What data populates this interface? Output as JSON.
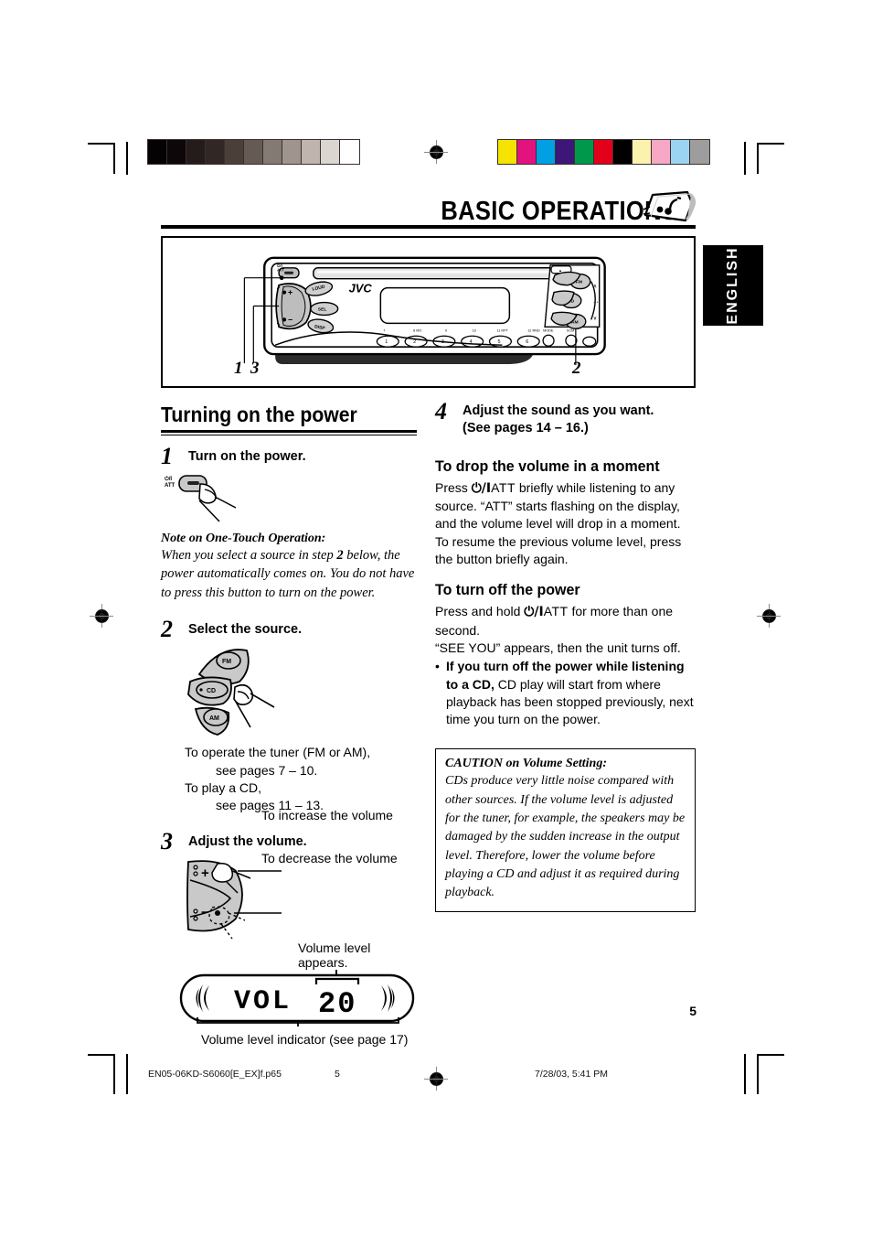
{
  "document": {
    "chapter_title": "BASIC OPERATIONS",
    "language_tab": "ENGLISH",
    "page_number": "5"
  },
  "unit_diagram": {
    "brand": "JVC",
    "callouts": [
      "1",
      "3",
      "2"
    ],
    "preset_numbers": [
      "1",
      "2",
      "3",
      "4",
      "5",
      "6"
    ],
    "band_labels": [
      "7",
      "8  MO",
      "9",
      "10",
      "11  RPT",
      "12  RND"
    ],
    "left_buttons": [
      "LOUD",
      "SEL",
      "DISP"
    ],
    "source_buttons": [
      "FM",
      "CD",
      "AM"
    ],
    "small_buttons": [
      "MODE",
      "SCM"
    ],
    "power_label_top": "ATT"
  },
  "left_column": {
    "section_heading": "Turning on the power",
    "steps": [
      {
        "number": "1",
        "title": "Turn on the power.",
        "icon_labels": [
          "ATT"
        ],
        "note_heading": "Note on One-Touch Operation:",
        "note_body_part1": "When you select a source in step ",
        "note_body_bold": "2",
        "note_body_part2": " below, the power automatically comes on. You do not have to press this button to turn on the power."
      },
      {
        "number": "2",
        "title": "Select the source.",
        "source_buttons": [
          "FM",
          "CD",
          "AM"
        ],
        "lines": [
          "To operate the tuner (FM or AM),",
          "see pages 7 – 10.",
          "To play a CD,",
          "see pages 11 – 13."
        ]
      },
      {
        "number": "3",
        "title": "Adjust the volume.",
        "increase_label": "To increase the volume",
        "decrease_label": "To decrease the volume",
        "plus_sign": "+",
        "minus_sign": "–",
        "display_caption_top": "Volume level appears.",
        "display_caption_bottom": "Volume level indicator (see page 17)",
        "display_text": "VOL",
        "display_value": "20"
      }
    ]
  },
  "right_column": {
    "step4": {
      "number": "4",
      "title_line1": "Adjust the sound as you want.",
      "title_line2": "(See pages 14 – 16.)"
    },
    "drop_volume": {
      "heading": "To drop the volume in a moment",
      "press_label": "Press",
      "button_glyph": "⏻/I",
      "button_name": "ATT",
      "body": "briefly while listening to any source. “ATT” starts flashing on the display, and the volume level will drop in a moment. To resume the previous volume level, press the button briefly again."
    },
    "turn_off": {
      "heading": "To turn off the power",
      "press_label": "Press and hold",
      "button_glyph": "⏻/I",
      "button_name": "ATT",
      "body_line1": "for more than one second.",
      "body_line2": "“SEE YOU” appears, then the unit turns off.",
      "bullet_bold": "If you turn off the power while listening to a CD,",
      "bullet_rest": " CD play will start from where playback has been stopped previously, next time you turn on the power."
    },
    "caution": {
      "heading": "CAUTION on Volume Setting:",
      "body": "CDs produce very little noise compared with other sources. If the volume level is adjusted for the tuner, for example, the speakers may be damaged by the sudden increase in the output level. Therefore, lower the volume before playing a CD and adjust it as required during playback."
    }
  },
  "footer": {
    "filename": "EN05-06KD-S6060[E_EX]f.p65",
    "folio": "5",
    "timestamp": "7/28/03, 5:41 PM"
  },
  "colorbars": {
    "grayscale": [
      "#050203",
      "#0d0709",
      "#241c1b",
      "#312724",
      "#4a4039",
      "#655b54",
      "#847a74",
      "#a0948f",
      "#bfb4ae",
      "#dcd6d0",
      "#ffffff"
    ],
    "chroma": [
      "#f5e400",
      "#e2127e",
      "#00a0e3",
      "#3d1678",
      "#00984a",
      "#e3001b",
      "#000000",
      "#fbf2ae",
      "#f6a8c5",
      "#9bd4f2",
      "#9d9d9d"
    ]
  }
}
